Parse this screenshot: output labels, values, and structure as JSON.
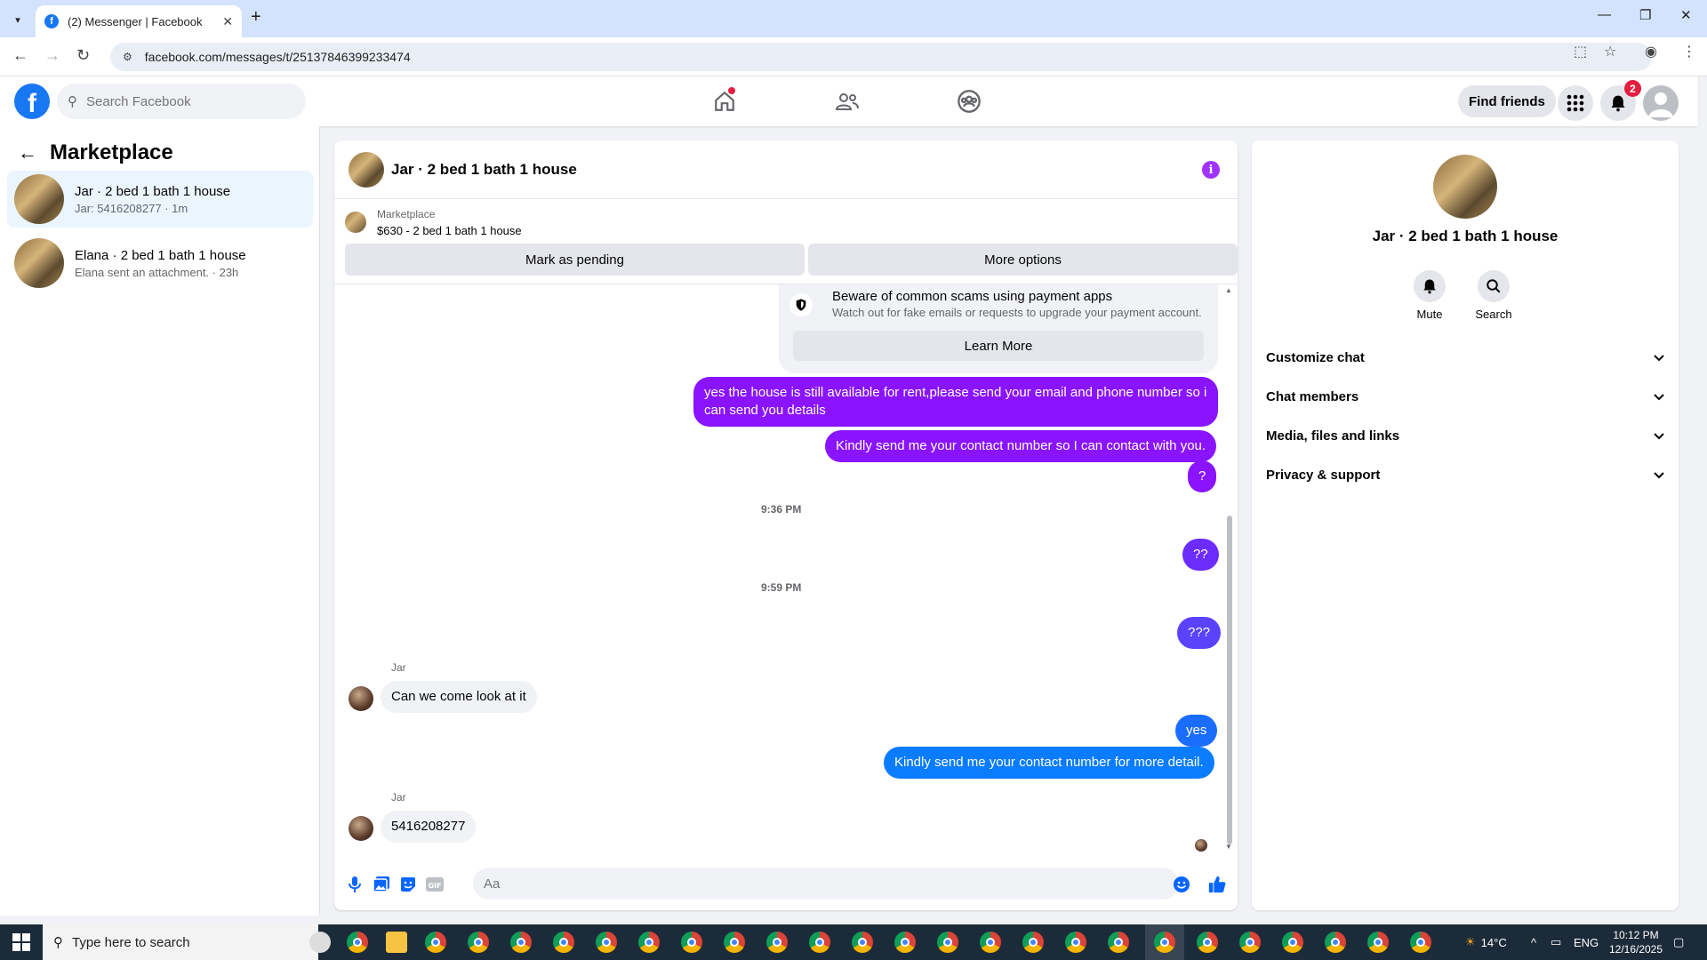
{
  "browser": {
    "tab_title": "(2) Messenger | Facebook",
    "url": "facebook.com/messages/t/25137846399233474"
  },
  "header": {
    "search_placeholder": "Search Facebook",
    "find_friends": "Find friends",
    "notification_count": "2"
  },
  "left": {
    "title": "Marketplace",
    "conversations": [
      {
        "name": "Jar · 2 bed 1 bath 1 house",
        "sub": "Jar: 5416208277 · 1m",
        "active": true
      },
      {
        "name": "Elana · 2 bed 1 bath 1 house",
        "sub": "Elana sent an attachment. · 23h",
        "active": false
      }
    ]
  },
  "chat": {
    "title": "Jar · 2 bed 1 bath 1 house",
    "marketplace_label": "Marketplace",
    "listing": "$630 - 2 bed 1 bath 1 house",
    "mark_pending": "Mark as pending",
    "more_options": "More options",
    "scam_title": "Beware of common scams using payment apps",
    "scam_sub": "Watch out for fake emails or requests to upgrade your payment account.",
    "learn_more": "Learn More",
    "messages": [
      {
        "text": "yes the house is still available for rent,please send your email and phone number so i can send you details"
      },
      {
        "text": "Kindly send me your contact number so I can contact with you."
      },
      {
        "text": "?"
      },
      {
        "time": "9:36 PM"
      },
      {
        "text": "??"
      },
      {
        "time": "9:59 PM"
      },
      {
        "text": "???"
      },
      {
        "sender": "Jar",
        "text": "Can we come look at it"
      },
      {
        "text": "yes"
      },
      {
        "text": "Kindly send me your contact number for more detail."
      },
      {
        "sender": "Jar",
        "text": "5416208277"
      }
    ],
    "composer_placeholder": "Aa"
  },
  "right": {
    "name": "Jar · 2 bed 1 bath 1 house",
    "mute": "Mute",
    "search": "Search",
    "sections": [
      "Customize chat",
      "Chat members",
      "Media, files and links",
      "Privacy & support"
    ]
  },
  "taskbar": {
    "search_placeholder": "Type here to search",
    "weather": "14°C",
    "lang": "ENG",
    "time": "10:12 PM",
    "date": "12/16/2025"
  },
  "colors": {
    "fb_blue": "#1877f2",
    "bubble_purple": "#8a14ff",
    "bubble_blue": "#0a7cff",
    "info_purple": "#a033ff"
  }
}
